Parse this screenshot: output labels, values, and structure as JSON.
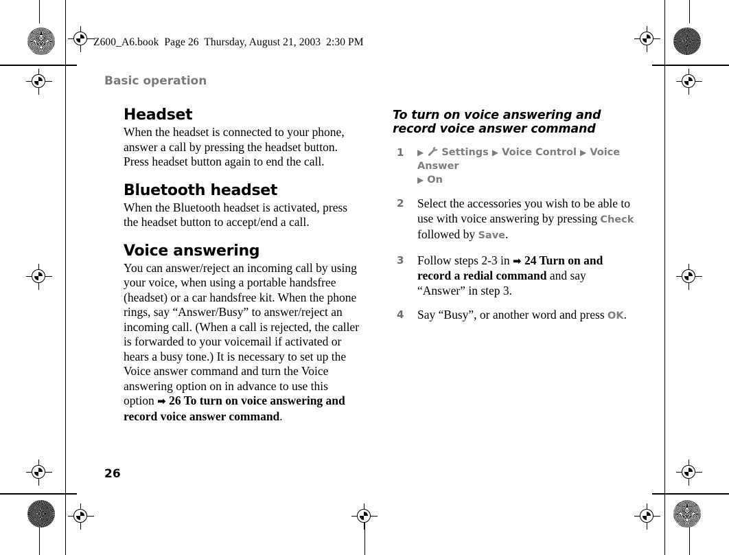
{
  "print_header": {
    "text": "Z600_A6.book  Page 26  Thursday, August 21, 2003  2:30 PM"
  },
  "running_head": "Basic operation",
  "page_number": "26",
  "colors": {
    "ui_term_gray": "#7d7d7d",
    "running_head_gray": "#7a7a7a",
    "step_number_gray": "#6f6f6f",
    "body_black": "#000000"
  },
  "left_column": {
    "sections": [
      {
        "heading": "Headset",
        "body": "When the headset is connected to your phone, answer a call by pressing the headset button. Press headset button again to end the call."
      },
      {
        "heading": "Bluetooth headset",
        "body": "When the Bluetooth headset is activated, press the headset button to accept/end a call."
      },
      {
        "heading": "Voice answering",
        "body_part1": "You can answer/reject an incoming call by using your voice, when using a portable handsfree (headset) or a car handsfree kit. When the phone rings, say “Answer/Busy” to answer/reject an incoming call. (When a call is rejected, the caller is forwarded to your voicemail if activated or hears a busy tone.) It is necessary to set up the Voice answer command and turn the Voice answering option on in advance to use this option ",
        "xref_arrow": "➡",
        "xref_text": "26 To turn on voice answering and record voice answer command",
        "body_part2": "."
      }
    ]
  },
  "right_column": {
    "task_heading": "To turn on voice answering and record voice answer command",
    "steps": [
      {
        "number": "1",
        "type": "nav",
        "nav": {
          "arrow1": "▶",
          "icon": "wrench-icon",
          "item1": "Settings",
          "arrow2": "▶",
          "item2": "Voice Control",
          "arrow3": "▶",
          "item3": "Voice Answer",
          "arrow4": "▶",
          "item4": "On"
        }
      },
      {
        "number": "2",
        "type": "text",
        "text_part1": "Select the accessories you wish to be able to use with voice answering by pressing ",
        "ui1": "Check",
        "text_part2": " followed by ",
        "ui2": "Save",
        "text_part3": "."
      },
      {
        "number": "3",
        "type": "xref",
        "text_part1": "Follow steps 2-3 in ",
        "xref_arrow": "➡",
        "xref_text": "24 Turn on and record a redial command",
        "text_part2": " and say “Answer” in step 3."
      },
      {
        "number": "4",
        "type": "text_ui_end",
        "text_part1": "Say “Busy”, or another word and press ",
        "ui1": "OK",
        "text_part2": "."
      }
    ]
  },
  "print_marks": {
    "rosettes": [
      {
        "name": "rosette-top-left",
        "tone": "light"
      },
      {
        "name": "rosette-top-right",
        "tone": "dark"
      },
      {
        "name": "rosette-bottom-left",
        "tone": "mid"
      },
      {
        "name": "rosette-bottom-right",
        "tone": "light"
      }
    ]
  }
}
